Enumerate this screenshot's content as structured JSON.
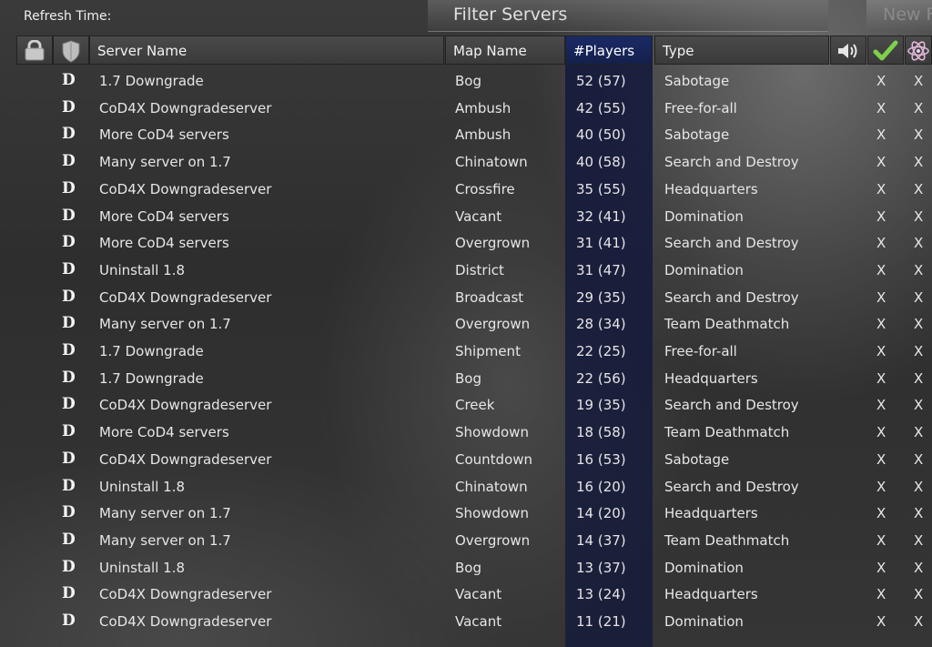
{
  "toolbar": {
    "refresh_label": "Refresh Time:",
    "filter_label": "Filter Servers",
    "new_label": "New F"
  },
  "columns": {
    "name": "Server Name",
    "map": "Map Name",
    "players": "#Players",
    "type": "Type"
  },
  "icons": {
    "lock": "lock-icon",
    "shield": "shield-icon",
    "sound": "speaker-icon",
    "check": "checkmark-icon",
    "atom": "atom-icon"
  },
  "colors": {
    "sorted_column": "#1b2a66",
    "header_bg": "#444444"
  },
  "rows": [
    {
      "d": "D",
      "name": "1.7 Downgrade",
      "map": "Bog",
      "players": "52 (57)",
      "type": "Sabotage",
      "x1": "X",
      "x2": "X"
    },
    {
      "d": "D",
      "name": "CoD4X Downgradeserver",
      "map": "Ambush",
      "players": "42 (55)",
      "type": "Free-for-all",
      "x1": "X",
      "x2": "X"
    },
    {
      "d": "D",
      "name": "More CoD4 servers",
      "map": "Ambush",
      "players": "40 (50)",
      "type": "Sabotage",
      "x1": "X",
      "x2": "X"
    },
    {
      "d": "D",
      "name": "Many server on 1.7",
      "map": "Chinatown",
      "players": "40 (58)",
      "type": "Search and Destroy",
      "x1": "X",
      "x2": "X"
    },
    {
      "d": "D",
      "name": "CoD4X Downgradeserver",
      "map": "Crossfire",
      "players": "35 (55)",
      "type": "Headquarters",
      "x1": "X",
      "x2": "X"
    },
    {
      "d": "D",
      "name": "More CoD4 servers",
      "map": "Vacant",
      "players": "32 (41)",
      "type": "Domination",
      "x1": "X",
      "x2": "X"
    },
    {
      "d": "D",
      "name": "More CoD4 servers",
      "map": "Overgrown",
      "players": "31 (41)",
      "type": "Search and Destroy",
      "x1": "X",
      "x2": "X"
    },
    {
      "d": "D",
      "name": "Uninstall 1.8",
      "map": "District",
      "players": "31 (47)",
      "type": "Domination",
      "x1": "X",
      "x2": "X"
    },
    {
      "d": "D",
      "name": "CoD4X Downgradeserver",
      "map": "Broadcast",
      "players": "29 (35)",
      "type": "Search and Destroy",
      "x1": "X",
      "x2": "X"
    },
    {
      "d": "D",
      "name": "Many server on 1.7",
      "map": "Overgrown",
      "players": "28 (34)",
      "type": "Team Deathmatch",
      "x1": "X",
      "x2": "X"
    },
    {
      "d": "D",
      "name": "1.7 Downgrade",
      "map": "Shipment",
      "players": "22 (25)",
      "type": "Free-for-all",
      "x1": "X",
      "x2": "X"
    },
    {
      "d": "D",
      "name": "1.7 Downgrade",
      "map": "Bog",
      "players": "22 (56)",
      "type": "Headquarters",
      "x1": "X",
      "x2": "X"
    },
    {
      "d": "D",
      "name": "CoD4X Downgradeserver",
      "map": "Creek",
      "players": "19 (35)",
      "type": "Search and Destroy",
      "x1": "X",
      "x2": "X"
    },
    {
      "d": "D",
      "name": "More CoD4 servers",
      "map": "Showdown",
      "players": "18 (58)",
      "type": "Team Deathmatch",
      "x1": "X",
      "x2": "X"
    },
    {
      "d": "D",
      "name": "CoD4X Downgradeserver",
      "map": "Countdown",
      "players": "16 (53)",
      "type": "Sabotage",
      "x1": "X",
      "x2": "X"
    },
    {
      "d": "D",
      "name": "Uninstall 1.8",
      "map": "Chinatown",
      "players": "16 (20)",
      "type": "Search and Destroy",
      "x1": "X",
      "x2": "X"
    },
    {
      "d": "D",
      "name": "Many server on 1.7",
      "map": "Showdown",
      "players": "14 (20)",
      "type": "Headquarters",
      "x1": "X",
      "x2": "X"
    },
    {
      "d": "D",
      "name": "Many server on 1.7",
      "map": "Overgrown",
      "players": "14 (37)",
      "type": "Team Deathmatch",
      "x1": "X",
      "x2": "X"
    },
    {
      "d": "D",
      "name": "Uninstall 1.8",
      "map": "Bog",
      "players": "13 (37)",
      "type": "Domination",
      "x1": "X",
      "x2": "X"
    },
    {
      "d": "D",
      "name": "CoD4X Downgradeserver",
      "map": "Vacant",
      "players": "13 (24)",
      "type": "Headquarters",
      "x1": "X",
      "x2": "X"
    },
    {
      "d": "D",
      "name": "CoD4X Downgradeserver",
      "map": "Vacant",
      "players": "11 (21)",
      "type": "Domination",
      "x1": "X",
      "x2": "X"
    }
  ]
}
